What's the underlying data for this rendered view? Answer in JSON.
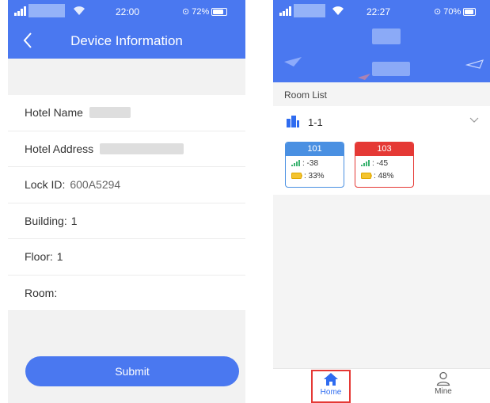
{
  "colors": {
    "accent": "#4a78f0",
    "online": "#4a90e2",
    "offline": "#e53935",
    "highlight_box": "#e53935"
  },
  "left": {
    "status": {
      "time": "22:00",
      "battery": "72%"
    },
    "header": {
      "title": "Device Information",
      "back_icon": "chevron-left-icon"
    },
    "fields": [
      {
        "label": "Hotel Name",
        "value": ""
      },
      {
        "label": "Hotel Address",
        "value": ""
      },
      {
        "label": "Lock ID:",
        "value": "600A5294"
      },
      {
        "label": "Building:",
        "value": "1"
      },
      {
        "label": "Floor:",
        "value": "1"
      },
      {
        "label": "Room:",
        "value": ""
      }
    ],
    "submit_label": "Submit"
  },
  "right": {
    "status": {
      "time": "22:27",
      "battery": "70%"
    },
    "room_list_label": "Room List",
    "group": {
      "name": "1-1",
      "icon": "building-icon",
      "expand_icon": "chevron-down-icon"
    },
    "rooms": [
      {
        "number": "101",
        "state": "online",
        "signal": ": -38",
        "battery": ": 33%"
      },
      {
        "number": "103",
        "state": "offline",
        "signal": ": -45",
        "battery": ": 48%"
      }
    ],
    "tabs": [
      {
        "label": "Home",
        "icon": "home-icon",
        "active": true
      },
      {
        "label": "Mine",
        "icon": "user-icon",
        "active": false
      }
    ]
  }
}
